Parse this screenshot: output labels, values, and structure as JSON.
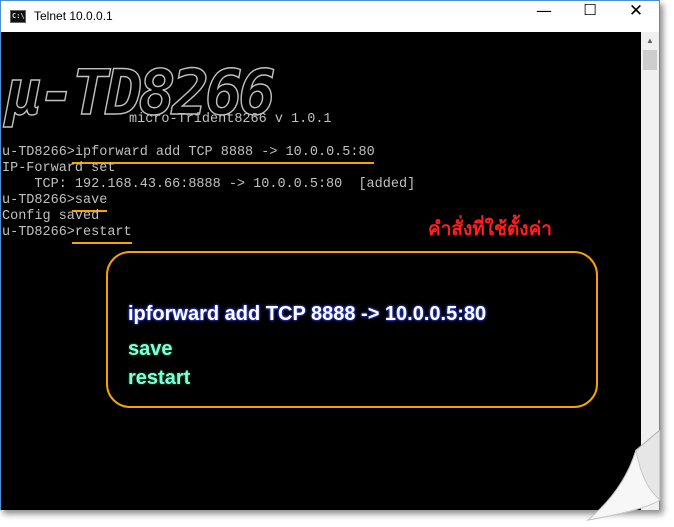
{
  "window": {
    "title": "Telnet 10.0.0.1",
    "app_icon_text": "C:\\",
    "controls": {
      "minimize": "—",
      "maximize": "☐",
      "close": "✕"
    }
  },
  "console": {
    "logo_text": "μ-TD8266",
    "version_line": "micro-Trident8266 v 1.0.1",
    "lines": [
      {
        "prompt": "u-TD8266>",
        "command": "ipforward add TCP 8888 -> 10.0.0.5:80"
      },
      {
        "text": "IP-Forward set"
      },
      {
        "text": "    TCP: 192.168.43.66:8888 -> 10.0.0.5:80  [added]"
      },
      {
        "prompt": "u-TD8266>",
        "command": "save"
      },
      {
        "text": "Config saved"
      },
      {
        "prompt": "u-TD8266>",
        "command": "restart"
      }
    ]
  },
  "annotation": {
    "heading": "คำสั่งที่ใช้ตั้งค่า",
    "commands": [
      "ipforward add TCP 8888 -> 10.0.0.5:80",
      "save",
      "restart"
    ],
    "colors": {
      "heading": "#ff1f1f",
      "box": "#f5a300",
      "cmd1": "#ffffff",
      "cmd2": "#7fffd4",
      "glow": "#3a4cff"
    }
  }
}
